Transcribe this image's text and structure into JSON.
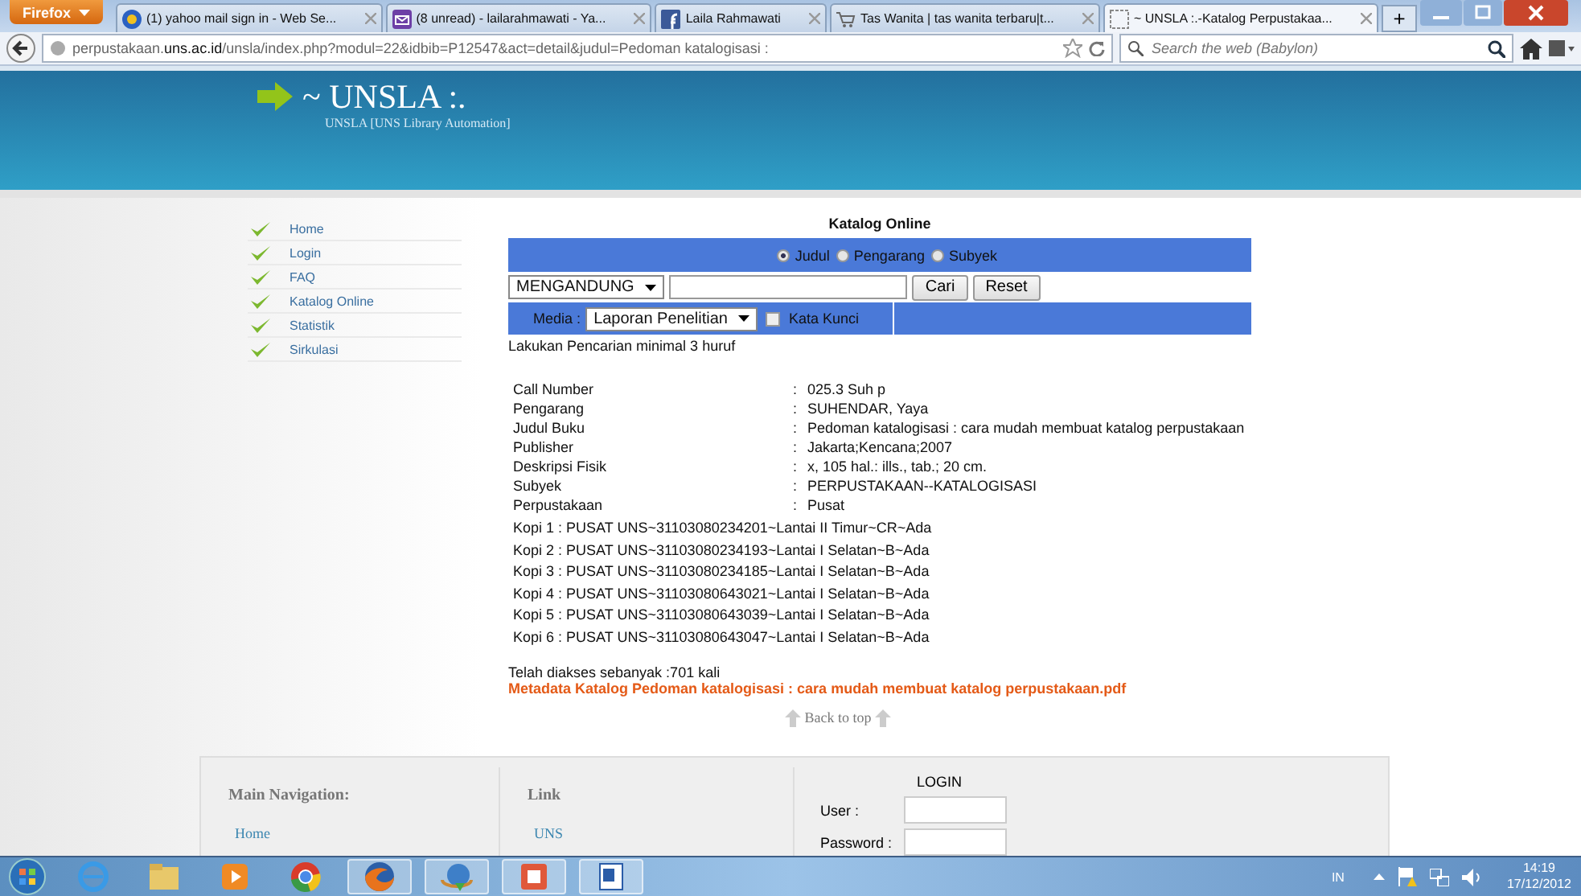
{
  "browser": {
    "menu_button": "Firefox",
    "tabs": [
      {
        "title": "(1) yahoo mail sign in - Web Se...",
        "kind": "circle",
        "selected": false
      },
      {
        "title": "(8 unread) - lailarahmawati - Ya...",
        "kind": "envelope",
        "selected": false
      },
      {
        "title": "Laila Rahmawati",
        "kind": "square",
        "selected": false
      },
      {
        "title": "Tas Wanita | tas wanita terbaru|t...",
        "kind": "cart",
        "selected": false
      },
      {
        "title": "~ UNSLA :.-Katalog Perpustakaa...",
        "kind": "blank",
        "selected": true
      }
    ],
    "new_tab": "+",
    "url_host_before": "perpustakaan.",
    "url_host_bold": "uns.ac.id",
    "url_rest": "/unsla/index.php?modul=22&idbib=P12547&act=detail&judul=Pedoman katalogisasi :",
    "search_placeholder": "Search the web (Babylon)"
  },
  "header": {
    "title": "~ UNSLA :.",
    "subtitle": "UNSLA [UNS Library Automation]"
  },
  "sidebar": {
    "items": [
      "Home",
      "Login",
      "FAQ",
      "Katalog Online",
      "Statistik",
      "Sirkulasi"
    ]
  },
  "catalog": {
    "title": "Katalog Online",
    "search_by": [
      {
        "label": "Judul",
        "selected": true
      },
      {
        "label": "Pengarang",
        "selected": false
      },
      {
        "label": "Subyek",
        "selected": false
      }
    ],
    "match": "MENGANDUNG",
    "buttons": [
      "Cari",
      "Reset"
    ],
    "media_label": "Media :",
    "media": "Laporan Penelitian",
    "keyword": {
      "label": "Kata Kunci",
      "checked": false
    },
    "hint": "Lakukan Pencarian minimal 3 huruf"
  },
  "details": [
    {
      "label": "Call Number",
      "separator": ":",
      "value": "025.3 Suh p"
    },
    {
      "label": "Pengarang",
      "separator": ":",
      "value": "SUHENDAR, Yaya"
    },
    {
      "label": "Judul Buku",
      "separator": ":",
      "value": "Pedoman katalogisasi : cara mudah membuat katalog perpustakaan"
    },
    {
      "label": "Publisher",
      "separator": ":",
      "value": "Jakarta;Kencana;2007"
    },
    {
      "label": "Deskripsi Fisik",
      "separator": ":",
      "value": "x, 105 hal.: ills., tab.; 20 cm."
    },
    {
      "label": "Subyek",
      "separator": ":",
      "value": "PERPUSTAKAAN--KATALOGISASI"
    },
    {
      "label": "Perpustakaan",
      "separator": ":",
      "value": "Pusat"
    }
  ],
  "copies": [
    "Kopi 1 : PUSAT UNS~31103080234201~Lantai II Timur~CR~Ada",
    "Kopi 2 : PUSAT UNS~31103080234193~Lantai I Selatan~B~Ada",
    "Kopi 3 : PUSAT UNS~31103080234185~Lantai I Selatan~B~Ada",
    "Kopi 4 : PUSAT UNS~31103080643021~Lantai I Selatan~B~Ada",
    "Kopi 5 : PUSAT UNS~31103080643039~Lantai I Selatan~B~Ada",
    "Kopi 6 : PUSAT UNS~31103080643047~Lantai I Selatan~B~Ada"
  ],
  "access_count": "Telah diakses sebanyak :701 kali",
  "metadata_link": "Metadata Katalog Pedoman katalogisasi : cara mudah membuat katalog perpustakaan.pdf",
  "back_to_top": "Back to top",
  "footer": {
    "main_nav_heading": "Main Navigation:",
    "main_nav_items": [
      "Home"
    ],
    "link_heading": "Link",
    "link_items": [
      "UNS"
    ],
    "login_title": "LOGIN",
    "login_fields": [
      "User :",
      "Password :"
    ]
  },
  "taskbar": {
    "language": "IN",
    "time": "14:19",
    "date": "17/12/2012"
  }
}
